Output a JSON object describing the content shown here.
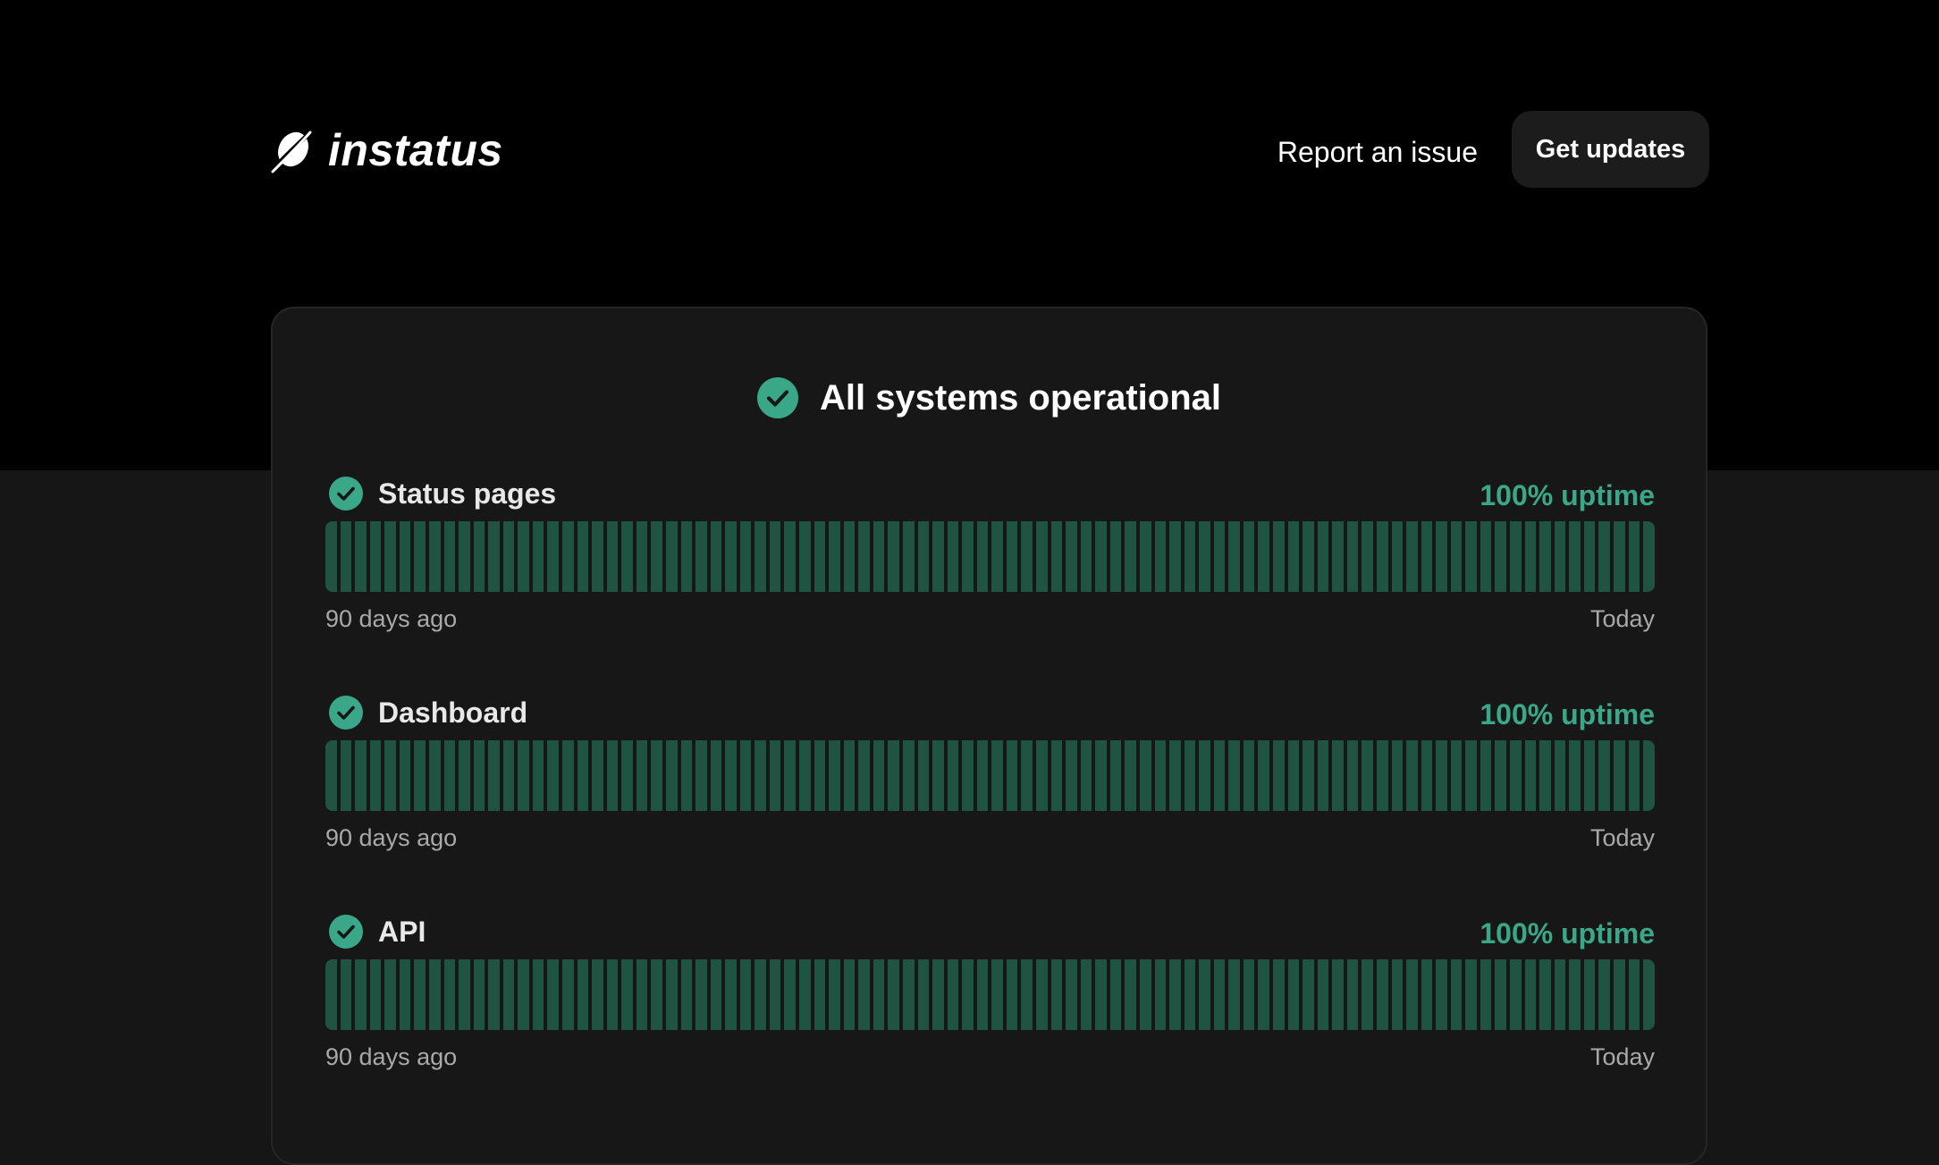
{
  "header": {
    "brand": "instatus",
    "report_label": "Report an issue",
    "updates_label": "Get updates"
  },
  "overall": {
    "status_text": "All systems operational",
    "icon": "check-circle-icon"
  },
  "services": [
    {
      "name": "Status pages",
      "uptime": "100% uptime",
      "range_start": "90 days ago",
      "range_end": "Today",
      "days": 90,
      "operational_days": 90
    },
    {
      "name": "Dashboard",
      "uptime": "100% uptime",
      "range_start": "90 days ago",
      "range_end": "Today",
      "days": 90,
      "operational_days": 90
    },
    {
      "name": "API",
      "uptime": "100% uptime",
      "range_start": "90 days ago",
      "range_end": "Today",
      "days": 90,
      "operational_days": 90
    }
  ],
  "colors": {
    "page_background": "#000000",
    "card_background": "#171717",
    "accent_green": "#3aa888",
    "uptime_bar": "#1f5443",
    "button_background": "#1c1c1c"
  }
}
